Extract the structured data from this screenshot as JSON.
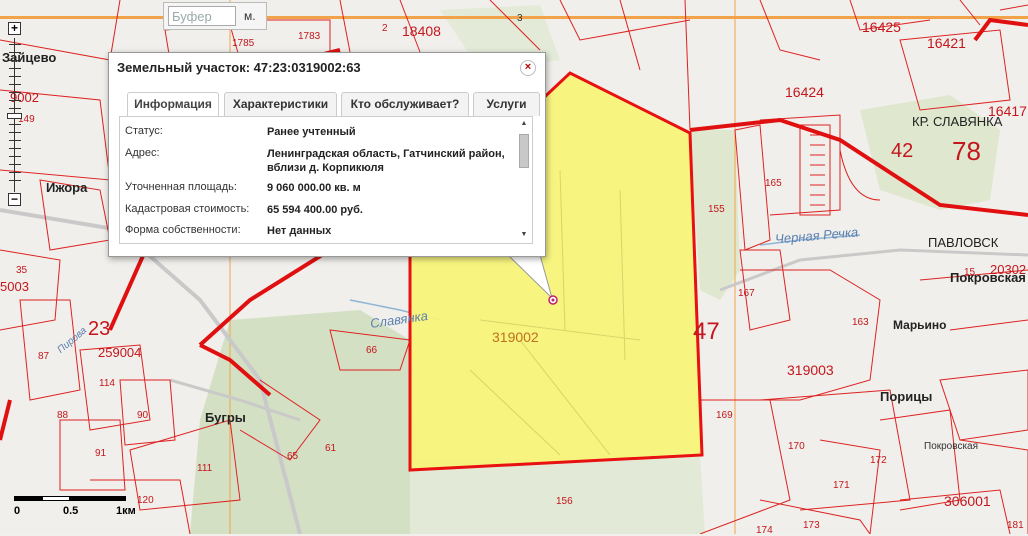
{
  "buffer": {
    "placeholder": "Буфер",
    "unit": "м."
  },
  "zoom": {
    "plus": "+",
    "minus": "−"
  },
  "scale": {
    "labels": [
      "0",
      "0.5",
      "1км"
    ]
  },
  "popup": {
    "title": "Земельный участок: 47:23:0319002:63",
    "close": "×",
    "tabs": [
      "Информация",
      "Характеристики",
      "Кто обслуживает?",
      "Услуги"
    ],
    "active_tab": "Информация",
    "rows": [
      {
        "label": "Статус:",
        "value": "Ранее учтенный"
      },
      {
        "label": "Адрес:",
        "value": "Ленинградская область, Гатчинский район, вблизи д. Корпикюля"
      },
      {
        "label": "Уточненная площадь:",
        "value": "9 060 000.00 кв. м"
      },
      {
        "label": "Кадастровая стоимость:",
        "value": "65 594 400.00 руб."
      },
      {
        "label": "Форма собственности:",
        "value": "Нет данных"
      }
    ]
  },
  "map": {
    "places": [
      "Зайцево",
      "Ижора",
      "Бугры",
      "КР. СЛАВЯНКА",
      "ПАВЛОВСК",
      "Покровская",
      "Марьино",
      "Порицы",
      "Покровская"
    ],
    "rivers": [
      "Славянка",
      "Черная Речка",
      "Пирова"
    ],
    "regions": [
      "47",
      "78",
      "42",
      "23"
    ],
    "quarters": [
      "319002",
      "319003",
      "259004",
      "306001",
      "18408",
      "16425",
      "16421",
      "16424",
      "16417",
      "20302"
    ],
    "parcels": [
      "1785",
      "1783",
      "2",
      "3",
      "155",
      "165",
      "167",
      "163",
      "169",
      "170",
      "171",
      "172",
      "173",
      "174",
      "156",
      "66",
      "65",
      "61",
      "111",
      "120",
      "114",
      "90",
      "91",
      "88",
      "87",
      "35",
      "149",
      "15",
      "181",
      "9002",
      "5003"
    ]
  }
}
